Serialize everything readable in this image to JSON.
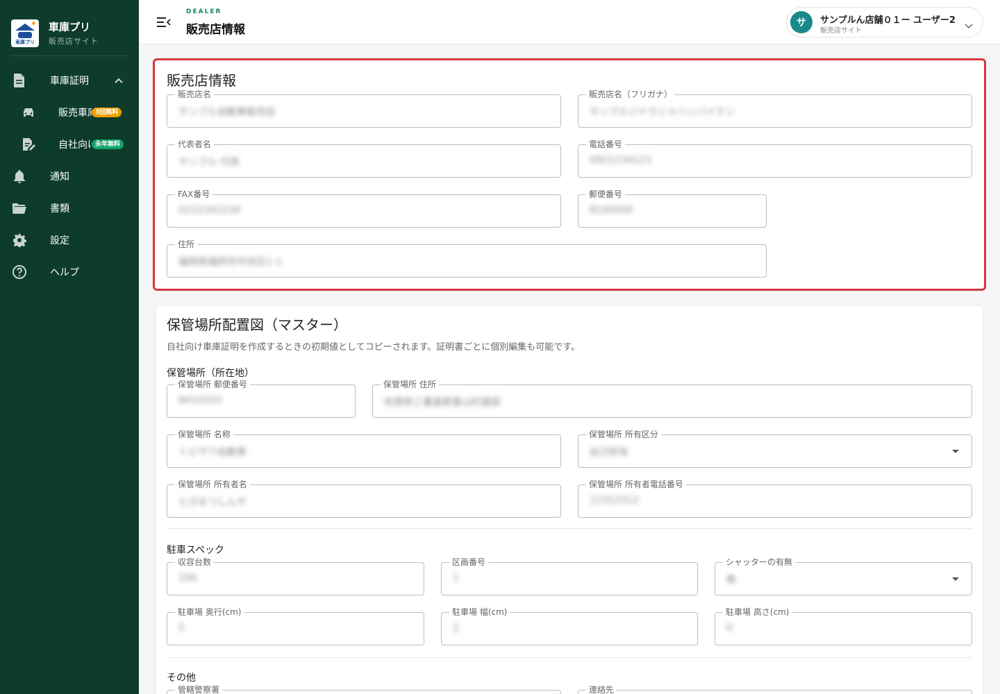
{
  "sidebar": {
    "brand_name": "車庫プリ",
    "brand_sub": "販売店サイト",
    "logo_text": "車庫プリ",
    "items": [
      {
        "label": "車庫証明",
        "icon": "document-icon"
      },
      {
        "label": "販売車庫証明",
        "icon": "car-icon",
        "badge": "3回無料",
        "badge_color": "#f0a000"
      },
      {
        "label": "自社向け車庫証明",
        "icon": "edit-document-icon",
        "badge": "永年無料",
        "badge_color": "#12a36a"
      },
      {
        "label": "通知",
        "icon": "bell-icon"
      },
      {
        "label": "書類",
        "icon": "folder-icon"
      },
      {
        "label": "設定",
        "icon": "gear-icon"
      },
      {
        "label": "ヘルプ",
        "icon": "help-icon"
      }
    ]
  },
  "header": {
    "eyebrow": "DEALER",
    "title": "販売店情報",
    "user": {
      "avatar": "サ",
      "name": "サンプルん店舗０１ー ユーザー2",
      "role": "販売店サイト"
    }
  },
  "dealer_card": {
    "title": "販売店情報",
    "fields": {
      "name": {
        "label": "販売店名",
        "value": "サンプル自動車販売店"
      },
      "name_kana": {
        "label": "販売店名（フリガナ）",
        "value": "サンプルジドウシャハンバイテン"
      },
      "representative": {
        "label": "代表者名",
        "value": "サンプル 代表"
      },
      "phone": {
        "label": "電話番号",
        "value": "0921234123"
      },
      "fax": {
        "label": "FAX番号",
        "value": "0212341234"
      },
      "postal": {
        "label": "郵便番号",
        "value": "8100000"
      },
      "address": {
        "label": "住所",
        "value": "福岡県福岡市中央区1-1"
      }
    }
  },
  "storage_card": {
    "title": "保管場所配置図（マスター）",
    "description": "自社向け車庫証明を作成するときの初期値としてコピーされます。証明書ごとに個別編集も可能です。",
    "location_section": "保管場所（所在地）",
    "fields": {
      "postal": {
        "label": "保管場所 郵便番号",
        "value": "8410203"
      },
      "address": {
        "label": "保管場所 住所",
        "value": "佐賀県三養基郡基山町園部"
      },
      "name": {
        "label": "保管場所 名称",
        "value": "トピサワ自動車"
      },
      "ownership": {
        "label": "保管場所 所有区分",
        "value": "自己所有"
      },
      "owner_name": {
        "label": "保管場所 所有者名",
        "value": "とぴまつしんや"
      },
      "owner_phone": {
        "label": "保管場所 所有者電話番号",
        "value": "12312312"
      }
    },
    "parking_section": "駐車スペック",
    "parking": {
      "capacity": {
        "label": "収容台数",
        "value": "100"
      },
      "lot_number": {
        "label": "区画番号",
        "value": "1"
      },
      "shutter": {
        "label": "シャッターの有無",
        "value": "無"
      },
      "depth": {
        "label": "駐車場 奥行(cm)",
        "value": "5"
      },
      "width": {
        "label": "駐車場 幅(cm)",
        "value": "2"
      },
      "height": {
        "label": "駐車場 高さ(cm)",
        "value": "0"
      }
    },
    "other_section": "その他",
    "other": {
      "police": {
        "label": "管轄警察署"
      },
      "contact": {
        "label": "連絡先"
      }
    }
  }
}
